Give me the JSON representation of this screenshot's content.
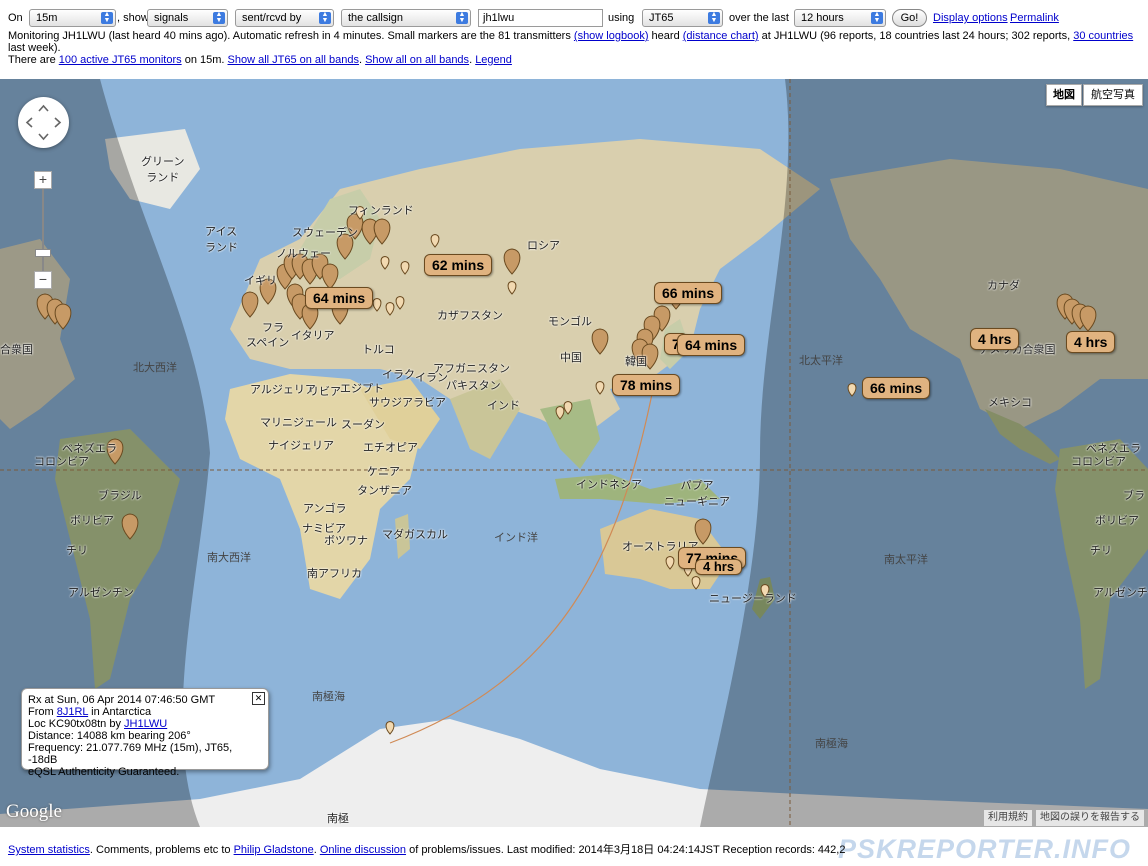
{
  "toolbar": {
    "on_label": "On",
    "band": "15m",
    "show_label": ", show",
    "show_value": "signals",
    "direction": "sent/rcvd by",
    "target": "the callsign",
    "callsign": "jh1lwu",
    "using_label": "using",
    "mode": "JT65",
    "over_label": "over the last",
    "period": "12 hours",
    "go_label": "Go!",
    "display_options": "Display options",
    "permalink": "Permalink"
  },
  "info": {
    "line1_a": "Monitoring JH1LWU (last heard 40 mins ago). Automatic refresh in 4 minutes. Small markers are the 81 transmitters ",
    "show_logbook": "(show logbook)",
    "line1_b": " heard ",
    "distance_chart": "(distance chart)",
    "line1_c": " at JH1LWU (96 reports, 18 countries last 24 hours; 302 reports, ",
    "countries_link": "30 countries",
    "line1_d": " last week).",
    "line2_a": "There are ",
    "monitors_link": "100 active JT65 monitors",
    "line2_b": " on 15m. ",
    "show_all_jt65": "Show all JT65 on all bands",
    "sep": ". ",
    "show_all_bands": "Show all on all bands",
    "legend": "Legend"
  },
  "map": {
    "map_type_map": "地図",
    "map_type_sat": "航空写真",
    "labels": {
      "greenland": "グリーン\nランド",
      "finland": "フィンランド",
      "sweden": "スウェーデン",
      "iceland": "アイス\nランド",
      "norway": "ノルウェー",
      "uk": "イギリ",
      "france": "フラ",
      "italy": "イタリア",
      "spain": "スペイン",
      "russia": "ロシア",
      "kazakhstan": "カザフスタン",
      "mongolia": "モンゴル",
      "china": "中国",
      "korea": "韓国",
      "turkey": "トルコ",
      "afghanistan": "アフガニスタン",
      "iraq": "イラク",
      "iran": "イラン",
      "pakistan": "パキスタン",
      "algeria": "アルジェリア",
      "libya": "リビア",
      "egypt": "エジプト",
      "saudi": "サウジアラビア",
      "india": "インド",
      "mali": "マリニジェール",
      "sudan": "スーダン",
      "nigeria": "ナイジェリア",
      "ethiopia": "エチオピア",
      "kenya": "ケニア",
      "tanzania": "タンザニア",
      "angola": "アンゴラ",
      "namibia": "ナミビア",
      "botswana": "ボツワナ",
      "madagascar": "マダガスカル",
      "south_africa": "南アフリカ",
      "indonesia": "インドネシア",
      "png": "パプア\nニューギニア",
      "australia": "オーストラリア",
      "new_zealand": "ニュージーランド",
      "north_atlantic": "北大西洋",
      "south_atlantic": "南大西洋",
      "indian_ocean": "インド洋",
      "north_pacific": "北太平洋",
      "south_pacific": "南太平洋",
      "southern_ocean": "南極海",
      "southern_ocean2": "南極海",
      "antarctica": "南極",
      "canada": "カナダ",
      "usa": "アメリカ合衆国",
      "mexico": "メキシコ",
      "venezuela_l": "ベネズエラ",
      "colombia_l": "コロンビア",
      "brazil_l": "ブラジル",
      "bolivia_l": "ボリビア",
      "chile_l": "チリ",
      "argentina_l": "アルゼンチン",
      "venezuela_r": "ベネズエラ",
      "colombia_r": "コロンビア",
      "brazil_r": "ブラ",
      "bolivia_r": "ボリビア",
      "chile_r": "チリ",
      "argentina_r": "アルゼンチン",
      "usa_left": "合衆国"
    },
    "callouts": [
      "62 mins",
      "64 mins",
      "66 mins",
      "7",
      "64 mins",
      "78 mins",
      "4 hrs",
      "4 hrs",
      "66 mins",
      "77 mins",
      "4 hrs"
    ],
    "popup": {
      "line1": "Rx at Sun, 06 Apr 2014 07:46:50 GMT",
      "from_label": "From ",
      "from_call": "8J1RL",
      "from_suffix": " in Antarctica",
      "loc_label": "Loc KC90tx08tn by ",
      "loc_call": "JH1LWU",
      "distance": "Distance: 14088 km bearing 206°",
      "frequency": "Frequency: 21.077.769 MHz (15m), JT65, -18dB",
      "eqsl": "eQSL Authenticity Guaranteed.",
      "close": "✕"
    },
    "google": "Google",
    "terms": "利用規約",
    "report_error": "地図の誤りを報告する"
  },
  "footer": {
    "system_stats": "System statistics",
    "text_a": ". Comments, problems etc to ",
    "author": "Philip Gladstone",
    "sep": ". ",
    "online_discussion": "Online discussion",
    "text_b": " of problems/issues. Last modified: 2014年3月18日 04:24:14JST Reception records: 442,2",
    "brand": "PSKREPORTER.INFO"
  },
  "colors": {
    "ocean": "#8eb4d9",
    "land": "#e9e5d3",
    "night": "#000000",
    "callout": "#e0b380",
    "marker": "#c79a66",
    "link": "#0000cc"
  }
}
